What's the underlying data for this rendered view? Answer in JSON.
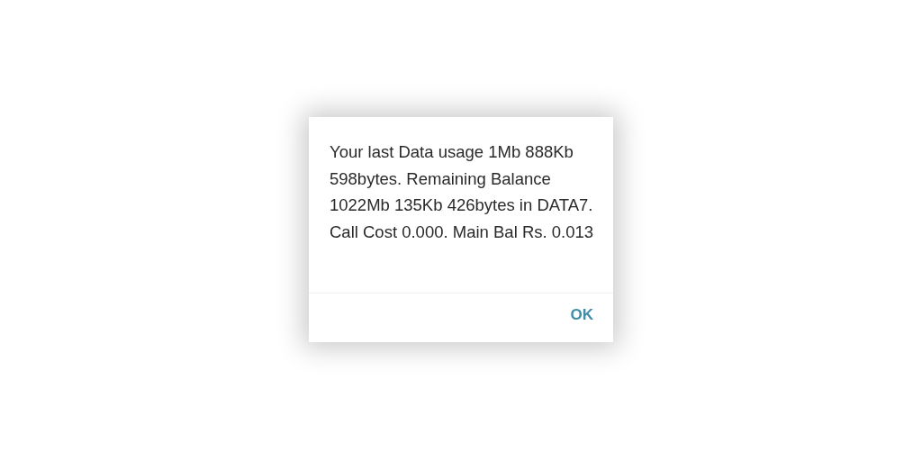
{
  "dialog": {
    "message": "Your last Data usage 1Mb 888Kb 598bytes. Remaining Balance 1022Mb 135Kb 426bytes in DATA7. Call Cost 0.000. Main Bal Rs. 0.013",
    "buttons": [
      "OK"
    ]
  }
}
